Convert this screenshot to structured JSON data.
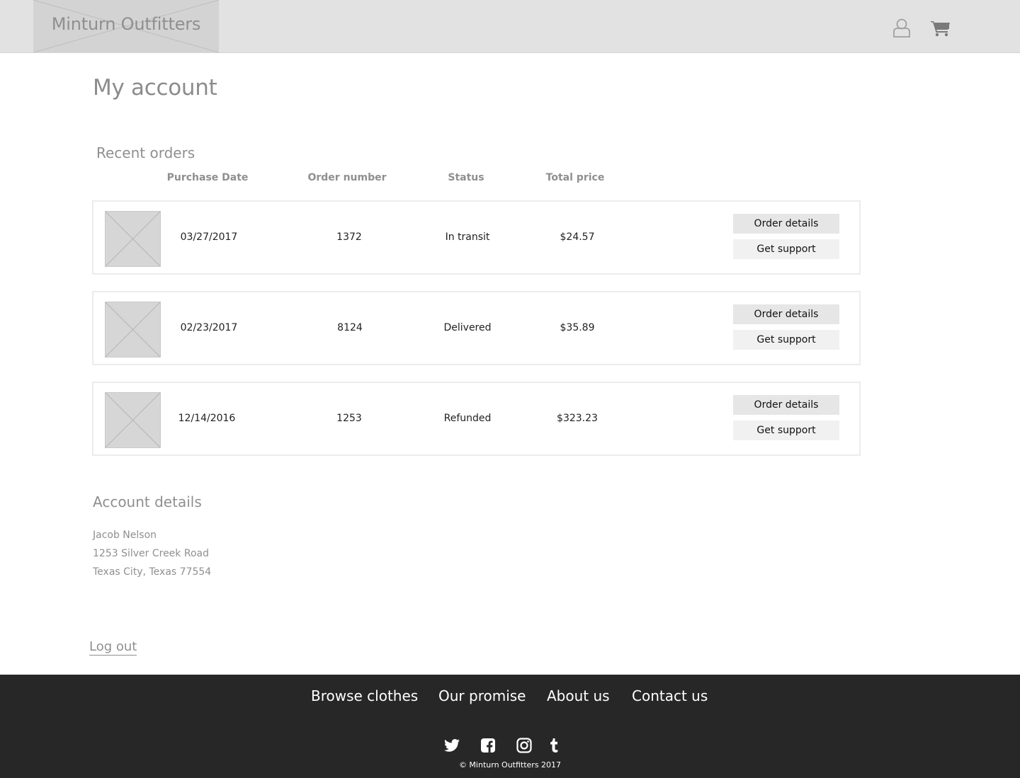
{
  "header": {
    "logo_text": "Minturn Outfitters",
    "icons": [
      "user-icon",
      "cart-icon"
    ]
  },
  "page_title": "My account",
  "recent_orders": {
    "title": "Recent orders",
    "columns": [
      "Purchase Date",
      "Order number",
      "Status",
      "Total price"
    ],
    "orders": [
      {
        "date": "03/27/2017",
        "number": "1372",
        "status": "In transit",
        "total": "$24.57",
        "details_label": "Order details",
        "support_label": "Get support"
      },
      {
        "date": "02/23/2017",
        "number": "8124",
        "status": "Delivered",
        "total": "$35.89",
        "details_label": "Order details",
        "support_label": "Get support"
      },
      {
        "date": "12/14/2016",
        "number": "1253",
        "status": "Refunded",
        "total": "$323.23",
        "details_label": "Order details",
        "support_label": "Get support"
      }
    ]
  },
  "account_details": {
    "title": "Account details",
    "lines": [
      "Jacob Nelson",
      "1253 Silver Creek Road",
      "Texas City, Texas 77554"
    ]
  },
  "logout_label": "Log out",
  "footer": {
    "links": [
      "Browse clothes",
      "Our promise",
      "About us",
      "Contact us"
    ],
    "social_icons": [
      "twitter-icon",
      "facebook-icon",
      "instagram-icon",
      "tumblr-icon"
    ],
    "copyright": "© Minturn Outfitters 2017"
  },
  "colors": {
    "header_bg": "#e2e2e2",
    "footer_bg": "#272727",
    "muted_text": "#8f8f8f"
  }
}
